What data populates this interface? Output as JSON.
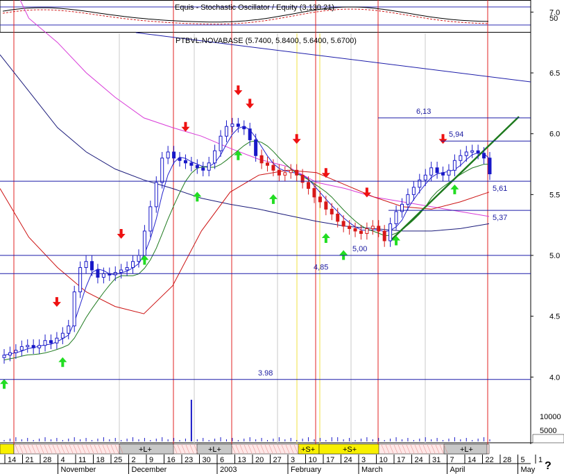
{
  "chart_data": {
    "type": "candlestick",
    "instrument_label": "PTBVL.NOVABASE (5.7400, 5.8400, 5.6400, 5.6700)",
    "oscillator_label": "Equis - Stochastic Oscillator / Equity (3,130.21)",
    "oscillator_level": "50",
    "price_axis_ticks": [
      "7.0",
      "6.5",
      "6.0",
      "5.5",
      "5.0",
      "4.5",
      "4.0"
    ],
    "volume_axis_ticks": [
      "10000",
      "5000"
    ],
    "date_ticks": [
      "14",
      "21",
      "28",
      "4",
      "11",
      "18",
      "25",
      "2",
      "9",
      "16",
      "23",
      "30",
      "6",
      "13",
      "20",
      "27",
      "3",
      "10",
      "17",
      "24",
      "3",
      "10",
      "17",
      "24",
      "31",
      "7",
      "14",
      "22",
      "28",
      "5",
      "1"
    ],
    "month_labels": [
      {
        "label": "November",
        "tick": 3
      },
      {
        "label": "December",
        "tick": 7
      },
      {
        "label": "2003",
        "tick": 12
      },
      {
        "label": "February",
        "tick": 16
      },
      {
        "label": "March",
        "tick": 20
      },
      {
        "label": "April",
        "tick": 25
      },
      {
        "label": "May",
        "tick": 29
      }
    ],
    "levels": [
      {
        "value": 6.13,
        "label": "6,13"
      },
      {
        "value": 5.94,
        "label": "5,94"
      },
      {
        "value": 5.61,
        "label": "5,61"
      },
      {
        "value": 5.37,
        "label": "5,37"
      },
      {
        "value": 5.0,
        "label": "5,00"
      },
      {
        "value": 4.85,
        "label": "4,85"
      },
      {
        "value": 3.98,
        "label": "3.98"
      }
    ],
    "closes": [
      4.18,
      4.2,
      4.22,
      4.25,
      4.26,
      4.24,
      4.26,
      4.3,
      4.28,
      4.32,
      4.36,
      4.42,
      4.7,
      4.9,
      4.95,
      4.88,
      4.82,
      4.85,
      4.84,
      4.86,
      4.88,
      4.9,
      4.95,
      5.0,
      5.2,
      5.4,
      5.6,
      5.8,
      5.85,
      5.8,
      5.78,
      5.76,
      5.74,
      5.72,
      5.7,
      5.76,
      5.86,
      5.98,
      6.06,
      6.08,
      6.06,
      6.04,
      5.95,
      5.82,
      5.76,
      5.74,
      5.7,
      5.66,
      5.68,
      5.7,
      5.66,
      5.6,
      5.55,
      5.48,
      5.44,
      5.38,
      5.34,
      5.28,
      5.24,
      5.22,
      5.2,
      5.18,
      5.22,
      5.24,
      5.2,
      5.12,
      5.26,
      5.36,
      5.42,
      5.5,
      5.56,
      5.62,
      5.66,
      5.72,
      5.68,
      5.66,
      5.7,
      5.78,
      5.82,
      5.85,
      5.86,
      5.84,
      5.8,
      5.67
    ],
    "signal_series": [
      {
        "name": "",
        "color": "#d83ad8",
        "values": [
          7.45,
          6.95,
          6.75,
          6.5,
          6.3,
          6.13,
          6.05,
          5.98,
          5.88,
          5.79,
          5.73,
          5.6,
          5.55,
          5.48,
          5.44,
          5.4,
          5.36,
          5.32
        ]
      },
      {
        "name": "",
        "color": "#1a1a7a",
        "values": [
          6.65,
          6.35,
          6.05,
          5.85,
          5.71,
          5.62,
          5.55,
          5.47,
          5.42,
          5.38,
          5.33,
          5.28,
          5.24,
          5.22,
          5.2,
          5.2,
          5.22,
          5.26
        ]
      },
      {
        "name": "",
        "color": "#cc1111",
        "values": [
          5.55,
          5.15,
          4.9,
          4.7,
          4.58,
          4.52,
          4.75,
          5.2,
          5.52,
          5.66,
          5.7,
          5.68,
          5.58,
          5.48,
          5.4,
          5.38,
          5.44,
          5.52
        ]
      }
    ],
    "trend_line": {
      "from": [
        66,
        5.12
      ],
      "to": [
        90,
        6.06
      ],
      "color": "#1e7a1e"
    },
    "pattern_labels": [
      {
        "label": "+L+",
        "tick": 7
      },
      {
        "label": "+L+",
        "tick": 11
      },
      {
        "label": "+S+",
        "tick": 16
      },
      {
        "label": "+S+",
        "tick": 18
      },
      {
        "label": "+L+",
        "tick": 26
      }
    ],
    "help_mark": "?"
  }
}
